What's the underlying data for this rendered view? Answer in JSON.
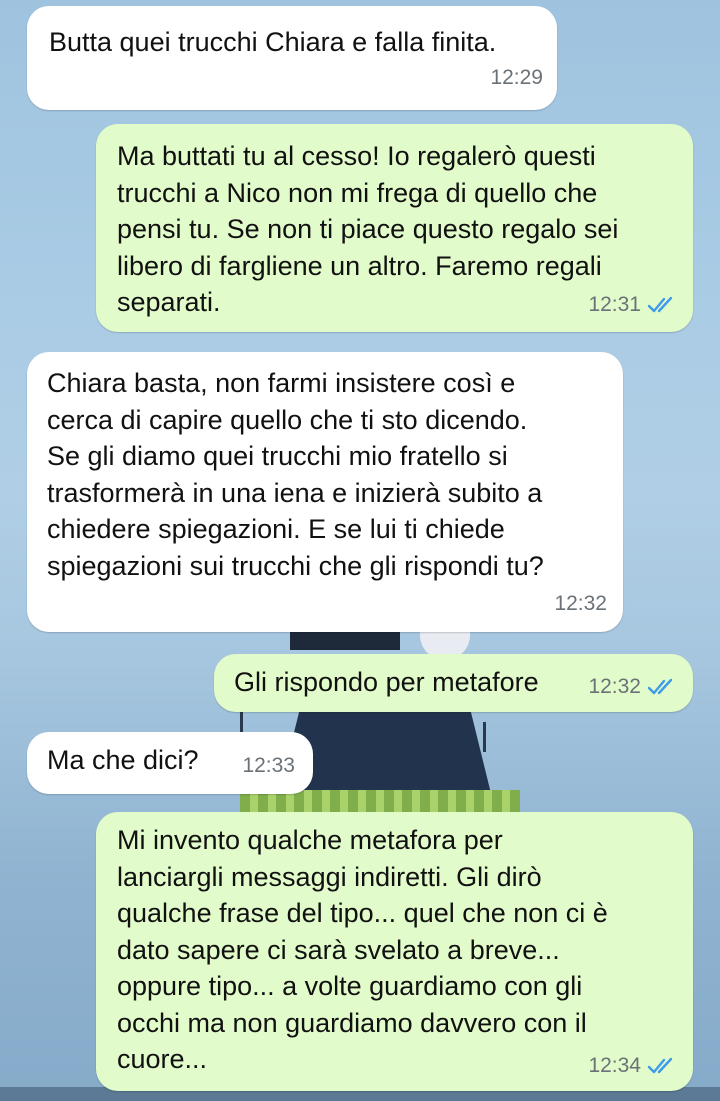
{
  "messages": [
    {
      "direction": "incoming",
      "text": "Butta quei trucchi Chiara e falla finita.",
      "time": "12:29"
    },
    {
      "direction": "outgoing",
      "text": "Ma buttati tu al cesso! Io regalerò questi\ntrucchi a Nico non mi frega di quello che\npensi tu. Se non ti piace questo regalo sei\nlibero di fargliene un altro. Faremo regali\nseparati.",
      "time": "12:31",
      "status": "read",
      "status_icon": "double-check-icon"
    },
    {
      "direction": "incoming",
      "text": "Chiara basta, non farmi insistere così e\ncerca di capire quello che ti sto dicendo.\nSe gli diamo quei trucchi mio fratello si\ntrasformerà in una iena e inizierà subito a\nchiedere spiegazioni. E se lui ti chiede\nspiegazioni sui trucchi che gli rispondi tu?",
      "time": "12:32"
    },
    {
      "direction": "outgoing",
      "text": "Gli rispondo per metafore",
      "time": "12:32",
      "status": "read",
      "status_icon": "double-check-icon"
    },
    {
      "direction": "incoming",
      "text": "Ma che dici?",
      "time": "12:33"
    },
    {
      "direction": "outgoing",
      "text": "Mi invento qualche metafora per\nlanciargli messaggi indiretti. Gli dirò\nqualche frase del tipo... quel che non ci è\ndato sapere ci sarà svelato a breve...\noppure tipo... a volte guardiamo con gli\nocchi ma non guardiamo davvero con il\ncuore...",
      "time": "12:34",
      "status": "read",
      "status_icon": "double-check-icon"
    }
  ],
  "colors": {
    "incoming_bubble": "#ffffff",
    "outgoing_bubble": "#e2fbca",
    "read_check": "#3d9be9",
    "timestamp": "#6b7277"
  }
}
